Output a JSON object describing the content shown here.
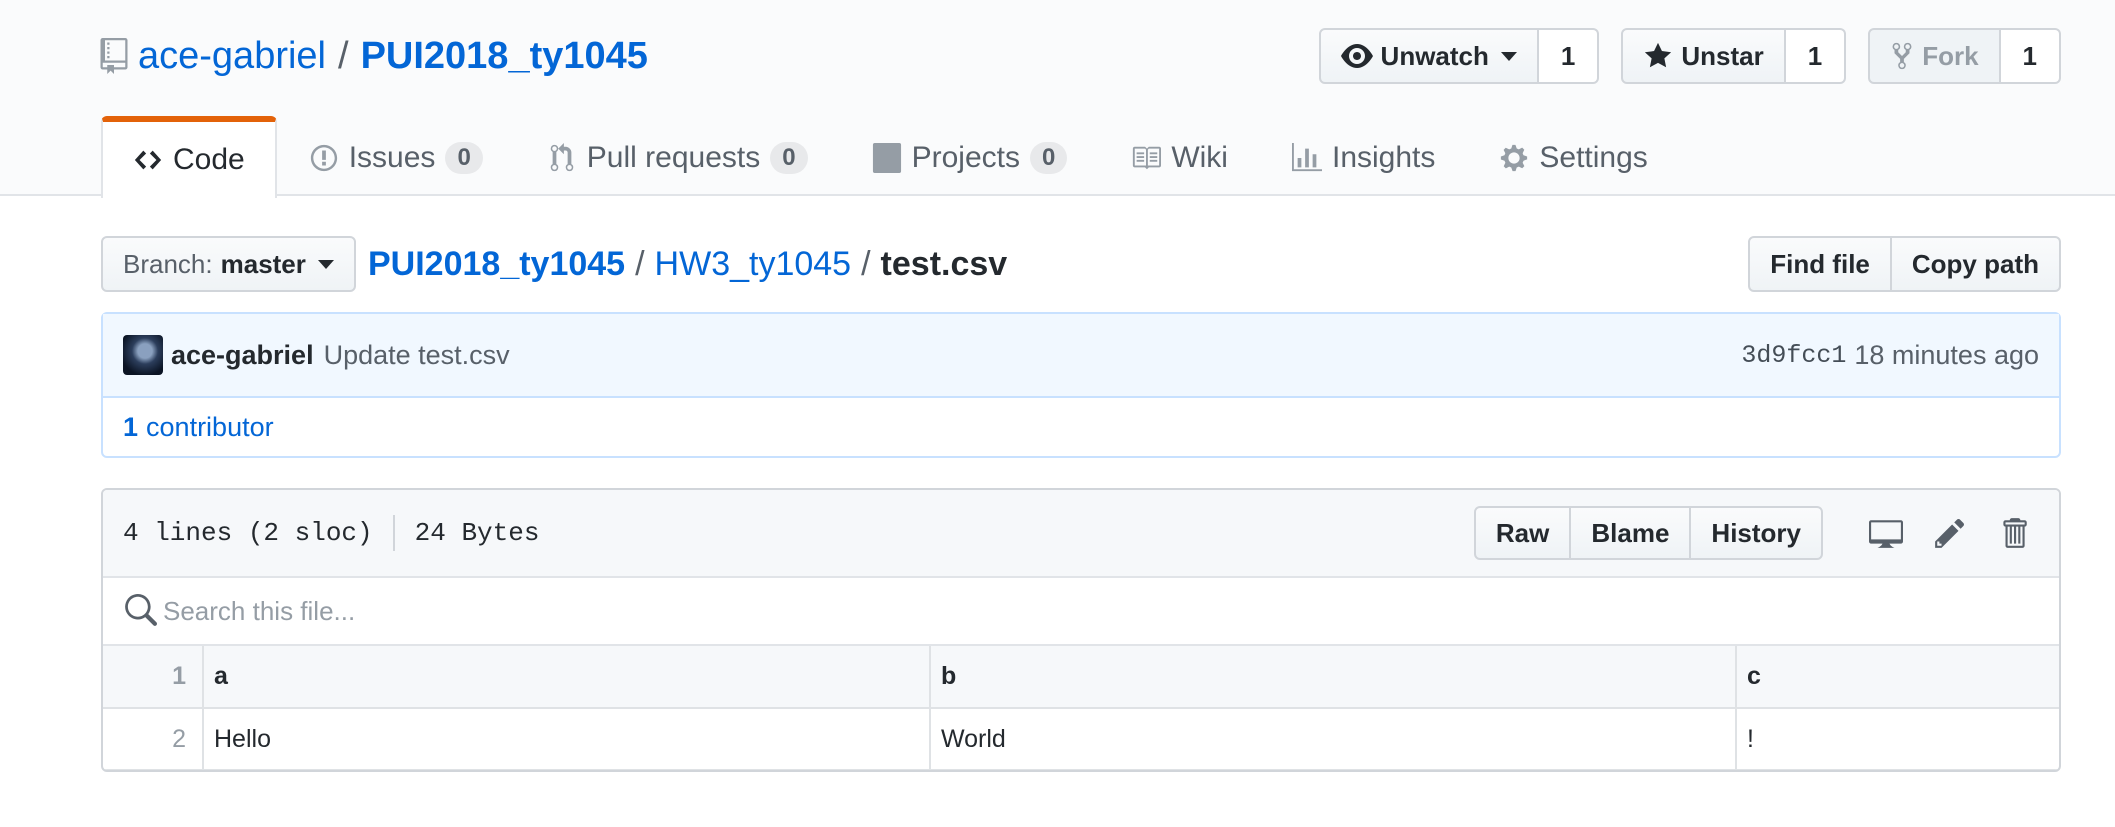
{
  "repo": {
    "owner": "ace-gabriel",
    "separator": "/",
    "name": "PUI2018_ty1045"
  },
  "actions": {
    "watch": {
      "label": "Unwatch",
      "count": "1"
    },
    "star": {
      "label": "Unstar",
      "count": "1"
    },
    "fork": {
      "label": "Fork",
      "count": "1"
    }
  },
  "nav": {
    "tabs": [
      {
        "label": "Code"
      },
      {
        "label": "Issues",
        "count": "0"
      },
      {
        "label": "Pull requests",
        "count": "0"
      },
      {
        "label": "Projects",
        "count": "0"
      },
      {
        "label": "Wiki"
      },
      {
        "label": "Insights"
      },
      {
        "label": "Settings"
      }
    ]
  },
  "branch": {
    "label": "Branch:",
    "value": "master"
  },
  "breadcrumb": {
    "root": "PUI2018_ty1045",
    "dir": "HW3_ty1045",
    "file": "test.csv",
    "sep": "/"
  },
  "file_nav": {
    "find_file": "Find file",
    "copy_path": "Copy path"
  },
  "commit": {
    "author": "ace-gabriel",
    "message": "Update test.csv",
    "sha": "3d9fcc1",
    "time": "18 minutes ago"
  },
  "contributors": {
    "count": "1",
    "label": "contributor"
  },
  "file": {
    "lines": "4 lines (2 sloc)",
    "size": "24 Bytes",
    "raw": "Raw",
    "blame": "Blame",
    "history": "History",
    "search_placeholder": "Search this file..."
  },
  "csv": {
    "header": {
      "line": "1",
      "cells": [
        "a",
        "b",
        "c"
      ]
    },
    "rows": [
      {
        "line": "2",
        "cells": [
          "Hello",
          "World",
          "!"
        ]
      }
    ]
  },
  "colors": {
    "link": "#0366d6",
    "accent_tab": "#e36209",
    "commit_bg": "#f1f8ff"
  }
}
